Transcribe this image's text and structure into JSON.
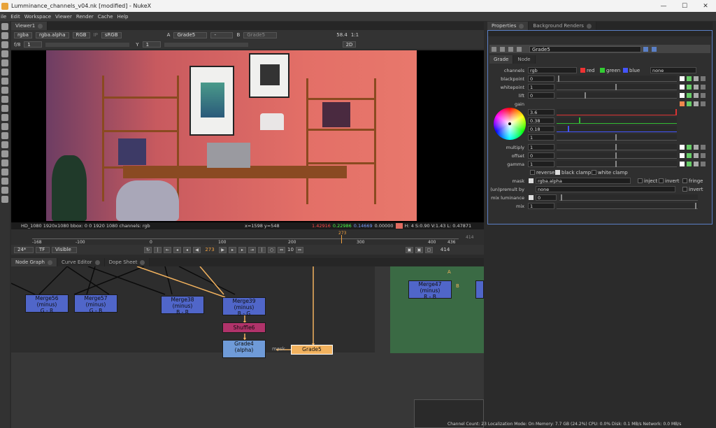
{
  "window": {
    "title": "Lumminance_channels_v04.nk [modified] - NukeX",
    "minimize": "—",
    "maximize": "☐",
    "close": "✕"
  },
  "menu": [
    "ile",
    "Edit",
    "Workspace",
    "Viewer",
    "Render",
    "Cache",
    "Help"
  ],
  "viewer": {
    "tab": "Viewer1",
    "channels": "rgba",
    "alpha": "rgba.alpha",
    "colorspace_rgb": "RGB",
    "ip": "IP",
    "lut": "sRGB",
    "input_a_label": "A",
    "input_a": "Grade5",
    "dash": "-",
    "input_b_label": "B",
    "input_b": "Grade5",
    "gain_value": "58.4",
    "ratio": "1:1",
    "frame": "f/8",
    "frame_val": "1",
    "y_label": "Y",
    "y_val": "1",
    "view": "2D",
    "info_left": "HD_1080 1920x1080  bbox: 0 0 1920 1080 channels: rgb",
    "info_xy": "x=1598 y=548",
    "info_r": "1.42916",
    "info_g": "0.22986",
    "info_b": "0.14669",
    "info_a": "0.00000",
    "info_hsv": "H: 4 S:0.90 V:1.43  L: 0.47871",
    "timeline_ticks": [
      "-168",
      "-100",
      "0",
      "100",
      "200",
      "300",
      "400",
      "436"
    ],
    "timeline_current": "273",
    "timeline_end": "414",
    "fps": "24*",
    "tf": "TF",
    "visible": "Visible",
    "current_frame": "273",
    "step": "10",
    "end_frame": "414"
  },
  "nodegraph": {
    "tabs": [
      "Node Graph",
      "Curve Editor",
      "Dope Sheet"
    ],
    "nodes": [
      {
        "line1": "Merge56 (minus)",
        "line2": "G - R"
      },
      {
        "line1": "Merge57 (minus)",
        "line2": "G - B"
      },
      {
        "line1": "Merge38 (minus)",
        "line2": "B - R"
      },
      {
        "line1": "Merge39 (minus)",
        "line2": "B - G"
      },
      {
        "line1": "Shuffle6",
        "line2": ""
      },
      {
        "line1": "Grade4",
        "line2": "(alpha)"
      },
      {
        "line1": "Grade5",
        "line2": ""
      },
      {
        "line1": "Merge47 (minus)",
        "line2": "R - B"
      }
    ],
    "mask_label": "mask",
    "pin_a": "A",
    "pin_b": "B"
  },
  "properties": {
    "tabs": [
      "Properties",
      "Background Renders"
    ],
    "node_name": "Grade5",
    "subtabs": [
      "Grade",
      "Node"
    ],
    "channels_label": "channels",
    "channels_value": "rgb",
    "ch_red": "red",
    "ch_green": "green",
    "ch_blue": "blue",
    "ch_none": "none",
    "rows": [
      {
        "label": "blackpoint",
        "value": "0"
      },
      {
        "label": "whitepoint",
        "value": "1"
      },
      {
        "label": "lift",
        "value": "0"
      },
      {
        "label": "gain",
        "value": ""
      }
    ],
    "gain_values": [
      "3.6",
      "0.38",
      "0.18",
      "1"
    ],
    "rows2": [
      {
        "label": "multiply",
        "value": "1"
      },
      {
        "label": "offset",
        "value": "0"
      },
      {
        "label": "gamma",
        "value": "1"
      }
    ],
    "reverse": "reverse",
    "black_clamp": "black clamp",
    "white_clamp": "white clamp",
    "mask_label": "mask",
    "mask_value": "rgba.alpha",
    "inject": "inject",
    "invert": "invert",
    "fringe": "fringe",
    "unpremult_label": "(un)premult by",
    "unpremult_value": "none",
    "invert2": "invert",
    "mixlum_label": "mix luminance",
    "mixlum_value": "0",
    "mix_label": "mix",
    "mix_value": "1",
    "slider_ticks": [
      "0",
      ".1",
      ".2",
      ".3",
      ".4",
      ".5",
      ".6",
      ".7",
      ".8",
      ".9",
      "1"
    ]
  },
  "status": "Channel Count: 23  Localization Mode: On  Memory: 7.7 GB (24.2%)  CPU: 0.0%  Disk: 0.1 MB/s  Network: 0.0 MB/s",
  "colors": {
    "node_merge": "#5066c9",
    "node_shuffle": "#b0336a",
    "node_grade4": "#6f9bd8",
    "node_grade5": "#f2b25e",
    "selection_border": "#5b80c6",
    "backdrop": "#3a6a44"
  }
}
